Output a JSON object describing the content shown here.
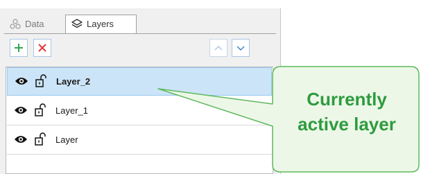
{
  "tabs": [
    {
      "label": "Data",
      "icon": "data-icon",
      "active": false
    },
    {
      "label": "Layers",
      "icon": "layers-icon",
      "active": true
    }
  ],
  "toolbar": {
    "add_icon": "plus-icon",
    "remove_icon": "x-icon",
    "up_icon": "chevron-up-icon",
    "down_icon": "chevron-down-icon",
    "add_color": "#2fa84f",
    "remove_color": "#e23a3a"
  },
  "layers": [
    {
      "name": "Layer_2",
      "selected": true,
      "visible_icon": "eye-icon",
      "lock_icon": "unlocked-icon"
    },
    {
      "name": "Layer_1",
      "selected": false,
      "visible_icon": "eye-icon",
      "lock_icon": "unlocked-icon"
    },
    {
      "name": "Layer",
      "selected": false,
      "visible_icon": "eye-icon",
      "lock_icon": "unlocked-icon"
    }
  ],
  "callout": {
    "line1": "Currently",
    "line2": "active layer",
    "text_color": "#2e9b3e",
    "border_color": "#5cb85c",
    "fill_color": "#edf7e8"
  },
  "colors": {
    "selection_bg": "#cce4f7",
    "selection_border": "#99c9ef",
    "panel_bg": "#f0f0f0"
  }
}
